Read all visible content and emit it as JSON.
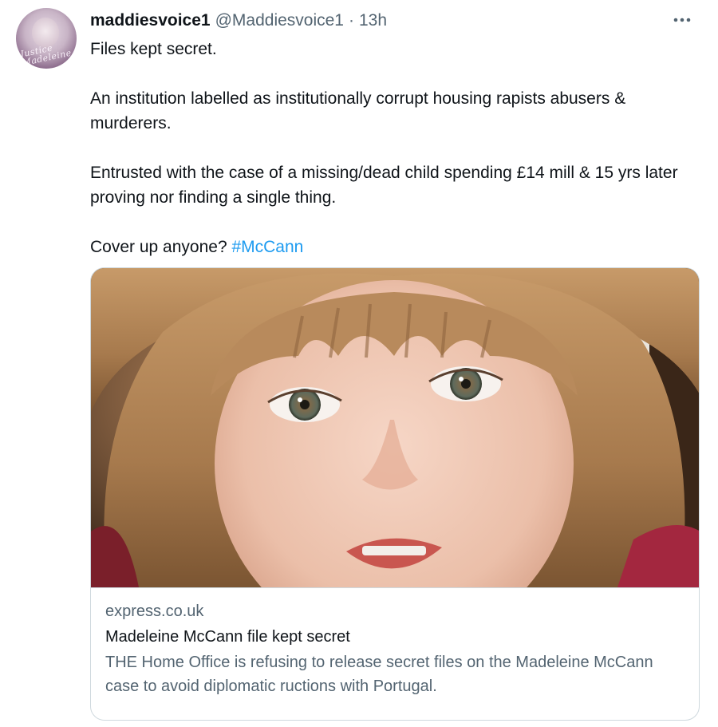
{
  "tweet": {
    "display_name": "maddiesvoice1",
    "handle": "@Maddiesvoice1",
    "separator": "·",
    "time": "13h",
    "more_icon": "more-horizontal-icon",
    "avatar_text": "Justice for Madeleine",
    "paragraphs": [
      "Files kept secret.",
      "An institution labelled as institutionally corrupt housing rapists abusers & murderers.",
      "Entrusted with the case of a missing/dead child spending £14 mill  & 15 yrs later proving nor finding a single thing."
    ],
    "last_line_text": "Cover up anyone? ",
    "hashtag": "#McCann",
    "colors": {
      "text": "#0f1419",
      "secondary": "#536471",
      "link": "#1d9bf0",
      "border": "#cfd9de"
    }
  },
  "card": {
    "domain": "express.co.uk",
    "title": "Madeleine McCann file kept secret",
    "description": "THE Home Office is refusing to release secret files on the Madeleine McCann case to avoid diplomatic ructions with Portugal.",
    "image": "child-portrait-photo"
  }
}
